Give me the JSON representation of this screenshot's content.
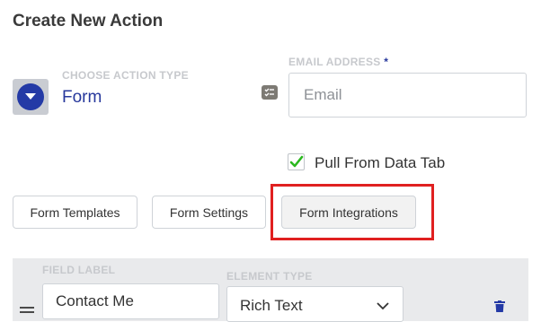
{
  "page": {
    "title": "Create New Action"
  },
  "action_type": {
    "label": "CHOOSE ACTION TYPE",
    "value": "Form",
    "icon": "dropdown-circle-icon"
  },
  "email": {
    "label": "EMAIL ADDRESS",
    "required_mark": "*",
    "placeholder": "Email",
    "value": "",
    "icon": "checklist-icon"
  },
  "pull_from_data_tab": {
    "label": "Pull From Data Tab",
    "checked": true
  },
  "buttons": {
    "form_templates": "Form Templates",
    "form_settings": "Form Settings",
    "form_integrations": "Form Integrations"
  },
  "field_row": {
    "field_label": {
      "label": "FIELD LABEL",
      "value": "Contact Me"
    },
    "element_type": {
      "label": "ELEMENT TYPE",
      "value": "Rich Text"
    },
    "delete_icon": "trash-icon",
    "drag_icon": "drag-handle-icon"
  },
  "colors": {
    "accent": "#27389c",
    "highlight": "#e02020",
    "check": "#2bb81f"
  }
}
